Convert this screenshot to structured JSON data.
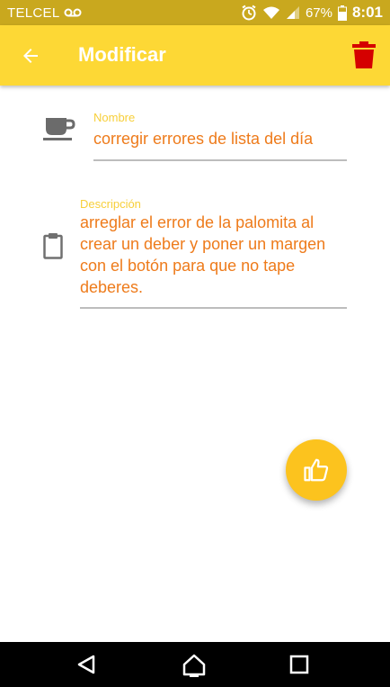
{
  "status_bar": {
    "carrier": "TELCEL",
    "battery": "67%",
    "time": "8:01"
  },
  "app_bar": {
    "title": "Modificar"
  },
  "form": {
    "name_label": "Nombre",
    "name_value": "corregir errores de lista del día",
    "description_label": "Descripción",
    "description_value": "arreglar el error de la palomita al crear un deber y poner un margen con el botón para que no tape deberes."
  },
  "colors": {
    "status_bar": "#c9a81e",
    "app_bar": "#fdd835",
    "delete_icon": "#d50000",
    "label": "#f7cf3a",
    "value": "#ee7b1b",
    "fab": "#fcc31e"
  },
  "icons": {
    "back": "arrow-left-icon",
    "delete": "trash-icon",
    "name_field": "coffee-cup-icon",
    "description_field": "clipboard-icon",
    "fab": "thumbs-up-icon"
  }
}
